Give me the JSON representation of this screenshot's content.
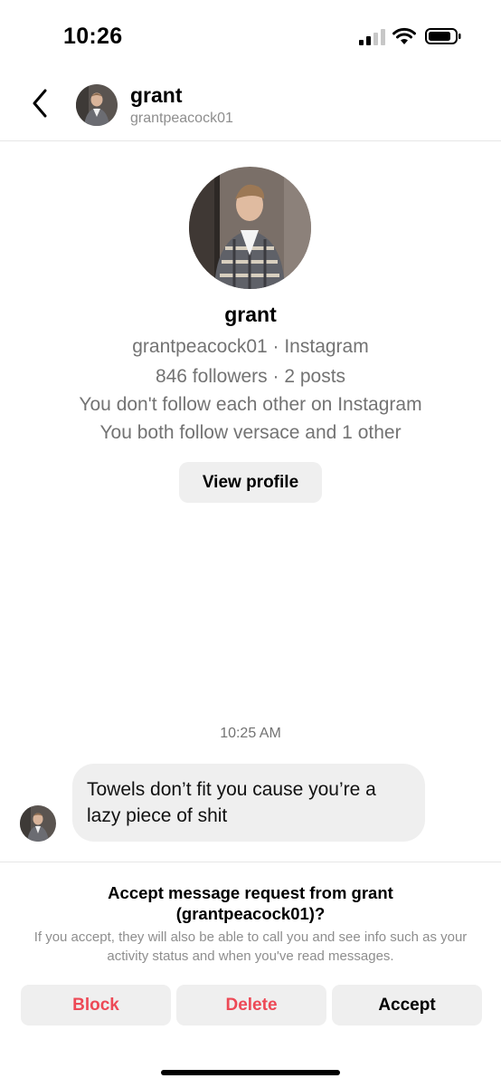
{
  "status_bar": {
    "time": "10:26"
  },
  "header": {
    "name": "grant",
    "username": "grantpeacock01"
  },
  "profile": {
    "name": "grant",
    "account_line": "grantpeacock01 · Instagram",
    "stats_line": "846 followers · 2 posts",
    "follow_line": "You don't follow each other on Instagram",
    "mutual_line": "You both follow versace and 1 other",
    "view_profile_label": "View profile"
  },
  "messages": {
    "timestamp": "10:25 AM",
    "items": [
      {
        "text": "Towels don’t fit you cause you’re a lazy piece of shit"
      }
    ]
  },
  "request": {
    "title": "Accept message request from grant (grantpeacock01)?",
    "description": "If you accept, they will also be able to call you and see info such as your activity status and when you've read messages.",
    "block_label": "Block",
    "delete_label": "Delete",
    "accept_label": "Accept"
  },
  "colors": {
    "danger": "#ed4956",
    "button_bg": "#efefef",
    "secondary_text": "#737373"
  },
  "icons": [
    "signal-icon",
    "wifi-icon",
    "battery-icon",
    "chevron-left-icon"
  ]
}
